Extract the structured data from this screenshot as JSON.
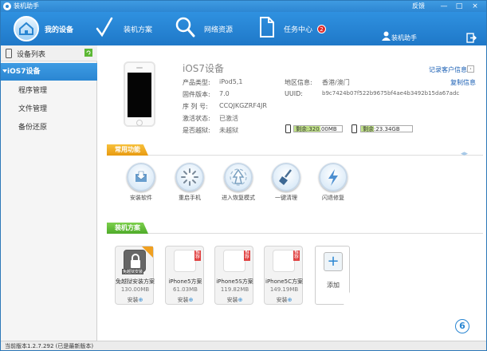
{
  "app": {
    "title": "装机助手",
    "feedback": "反馈"
  },
  "window_buttons": {
    "minimize": "—",
    "maximize": "□",
    "close": "×"
  },
  "nav": {
    "items": [
      {
        "label": "我的设备",
        "icon": "home-icon",
        "active": true
      },
      {
        "label": "装机方案",
        "icon": "checkmark-icon"
      },
      {
        "label": "网络资源",
        "icon": "search-icon"
      },
      {
        "label": "任务中心",
        "icon": "document-icon",
        "badge": "2"
      }
    ],
    "user": "装机助手",
    "exit_icon": "exit-icon"
  },
  "sidebar": {
    "header": "设备列表",
    "items": [
      {
        "label": "iOS7设备",
        "active": true
      },
      {
        "label": "程序管理"
      },
      {
        "label": "文件管理"
      },
      {
        "label": "备份还原"
      }
    ]
  },
  "device": {
    "name": "iOS7设备",
    "fields": [
      {
        "label": "产品类型:",
        "value": "iPod5,1"
      },
      {
        "label": "固件版本:",
        "value": "7.0"
      },
      {
        "label": "序 列 号:",
        "value": "CCQJKGZRF4JR"
      },
      {
        "label": "激活状态:",
        "value": "已激活"
      },
      {
        "label": "是否越狱:",
        "value": "未越狱"
      }
    ],
    "region_label": "地区信息:",
    "region_value": "香港/澳门",
    "uuid_label": "UUID:",
    "uuid_value": "b9c7424b07f522b9675bf4ae4b3492b15da67adc",
    "record_link": "记录客户信息",
    "copy_link": "复制信息",
    "storage": [
      {
        "label": "剩余:320.00MB",
        "fill": 0.55
      },
      {
        "label": "剩余:23.34GB",
        "fill": 0.25
      }
    ]
  },
  "functions": {
    "title": "常用功能",
    "items": [
      {
        "label": "安装软件",
        "icon": "install-icon"
      },
      {
        "label": "重启手机",
        "icon": "restart-icon"
      },
      {
        "label": "进入恢复模式",
        "icon": "recovery-icon"
      },
      {
        "label": "一键清理",
        "icon": "broom-icon"
      },
      {
        "label": "闪退修复",
        "icon": "lightning-icon"
      }
    ]
  },
  "plans": {
    "title": "装机方案",
    "items": [
      {
        "name": "免越狱安装方案",
        "size": "130.00MB",
        "action": "安装"
      },
      {
        "name": "iPhone5方案",
        "size": "61.03MB",
        "action": "安装"
      },
      {
        "name": "iPhone5S方案",
        "size": "119.82MB",
        "action": "安装"
      },
      {
        "name": "iPhone5C方案",
        "size": "149.19MB",
        "action": "安装"
      }
    ],
    "add_label": "添加",
    "recommend_flag": "推荐",
    "jailbreak_tag": "免越狱安装"
  },
  "colors": {
    "accent": "#2a86d2",
    "orange": "#f0a020",
    "green": "#5cb834"
  },
  "status": "当前版本1.2.7.292 (已是最新版本)"
}
